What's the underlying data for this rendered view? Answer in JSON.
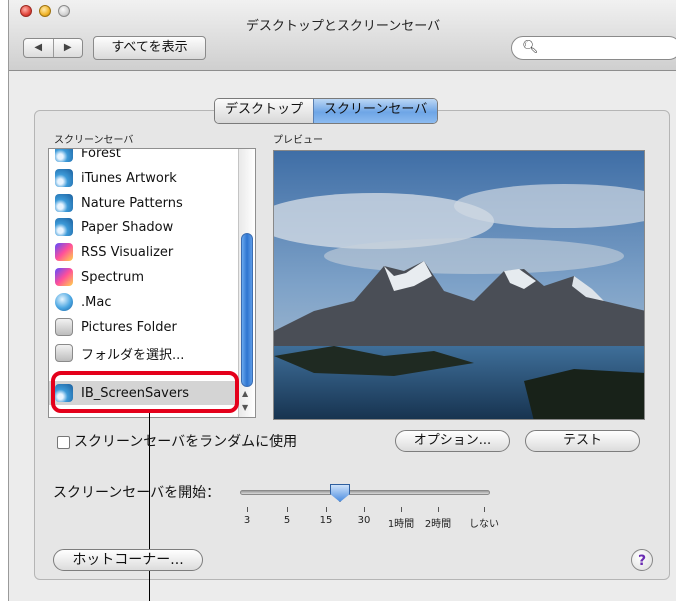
{
  "window": {
    "title": "デスクトップとスクリーンセーバ"
  },
  "toolbar": {
    "back": "◀",
    "forward": "▶",
    "show_all": "すべてを表示",
    "search_placeholder": ""
  },
  "tabs": [
    {
      "label": "デスクトップ"
    },
    {
      "label": "スクリーンセーバ"
    }
  ],
  "sidebar": {
    "header": "スクリーンセーバ",
    "items": [
      {
        "label": "Forest",
        "icon": "spiral-icon"
      },
      {
        "label": "iTunes Artwork",
        "icon": "spiral-icon"
      },
      {
        "label": "Nature Patterns",
        "icon": "spiral-icon"
      },
      {
        "label": "Paper Shadow",
        "icon": "spiral-icon"
      },
      {
        "label": "RSS Visualizer",
        "icon": "rss-icon"
      },
      {
        "label": "Spectrum",
        "icon": "spectrum-icon"
      },
      {
        "label": ".Mac",
        "icon": "globe-icon"
      },
      {
        "label": "Pictures Folder",
        "icon": "picture-icon"
      },
      {
        "label": "フォルダを選択...",
        "icon": "folder-icon"
      },
      {
        "label": "IB_ScreenSavers",
        "icon": "spiral-icon",
        "selected": true
      }
    ]
  },
  "preview": {
    "label": "プレビュー"
  },
  "options": {
    "random_label": "スクリーンセーバをランダムに使用",
    "options_button": "オプション...",
    "test_button": "テスト"
  },
  "start": {
    "label": "スクリーンセーバを開始：",
    "ticks": [
      "3",
      "5",
      "15",
      "30",
      "1時間",
      "2時間",
      "しない"
    ],
    "selected": "15"
  },
  "footer": {
    "hot_corners": "ホットコーナー...",
    "help": "?"
  },
  "colors": {
    "accent": "#3a80d9",
    "highlight": "#e4001b"
  }
}
